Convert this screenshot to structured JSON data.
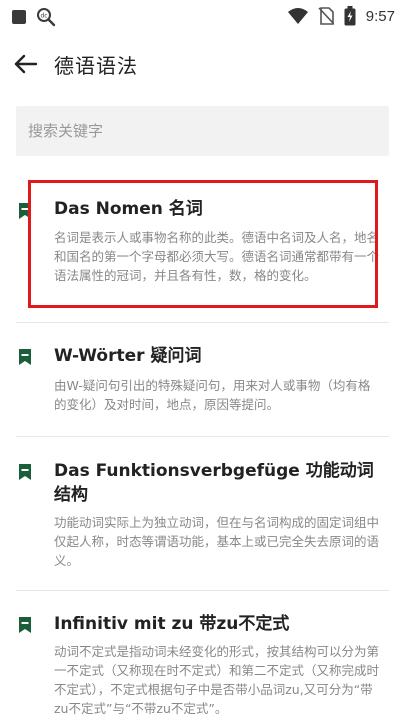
{
  "status_bar": {
    "time": "9:57",
    "icons": [
      "square-app-icon",
      "search-badge-icon",
      "wifi-icon",
      "no-sim-icon",
      "battery-icon"
    ]
  },
  "header": {
    "title": "德语语法",
    "back_icon": "back-arrow-icon"
  },
  "search": {
    "placeholder": "搜索关键字"
  },
  "items": [
    {
      "title": "Das Nomen 名词",
      "desc": "名词是表示人或事物名称的此类。德语中名词及人名，地名和国名的第一个字母都必须大写。德语名词通常都带有一个语法属性的冠词，并且各有性，数，格的变化。"
    },
    {
      "title": "W-Wörter 疑问词",
      "desc": "由W-疑问句引出的特殊疑问句，用来对人或事物（均有格的变化）及对时间，地点，原因等提问。"
    },
    {
      "title": "Das Funktionsverbgefüge 功能动词结构",
      "desc": "功能动词实际上为独立动词，但在与名词构成的固定词组中仅起人称，时态等谓语功能，基本上或已完全失去原词的语义。"
    },
    {
      "title": "Infinitiv mit zu  带zu不定式",
      "desc": "动词不定式是指动词未经变化的形式，按其结构可以分为第一不定式（又称现在时不定式）和第二不定式（又称完成时不定式），不定式根据句子中是否带小品词zu,又可分为“带zu不定式”与“不带zu不定式”。"
    }
  ],
  "colors": {
    "bookmark": "#1b5e3a",
    "highlight": "#e01a1a",
    "search_bg": "#f2f2f2"
  }
}
